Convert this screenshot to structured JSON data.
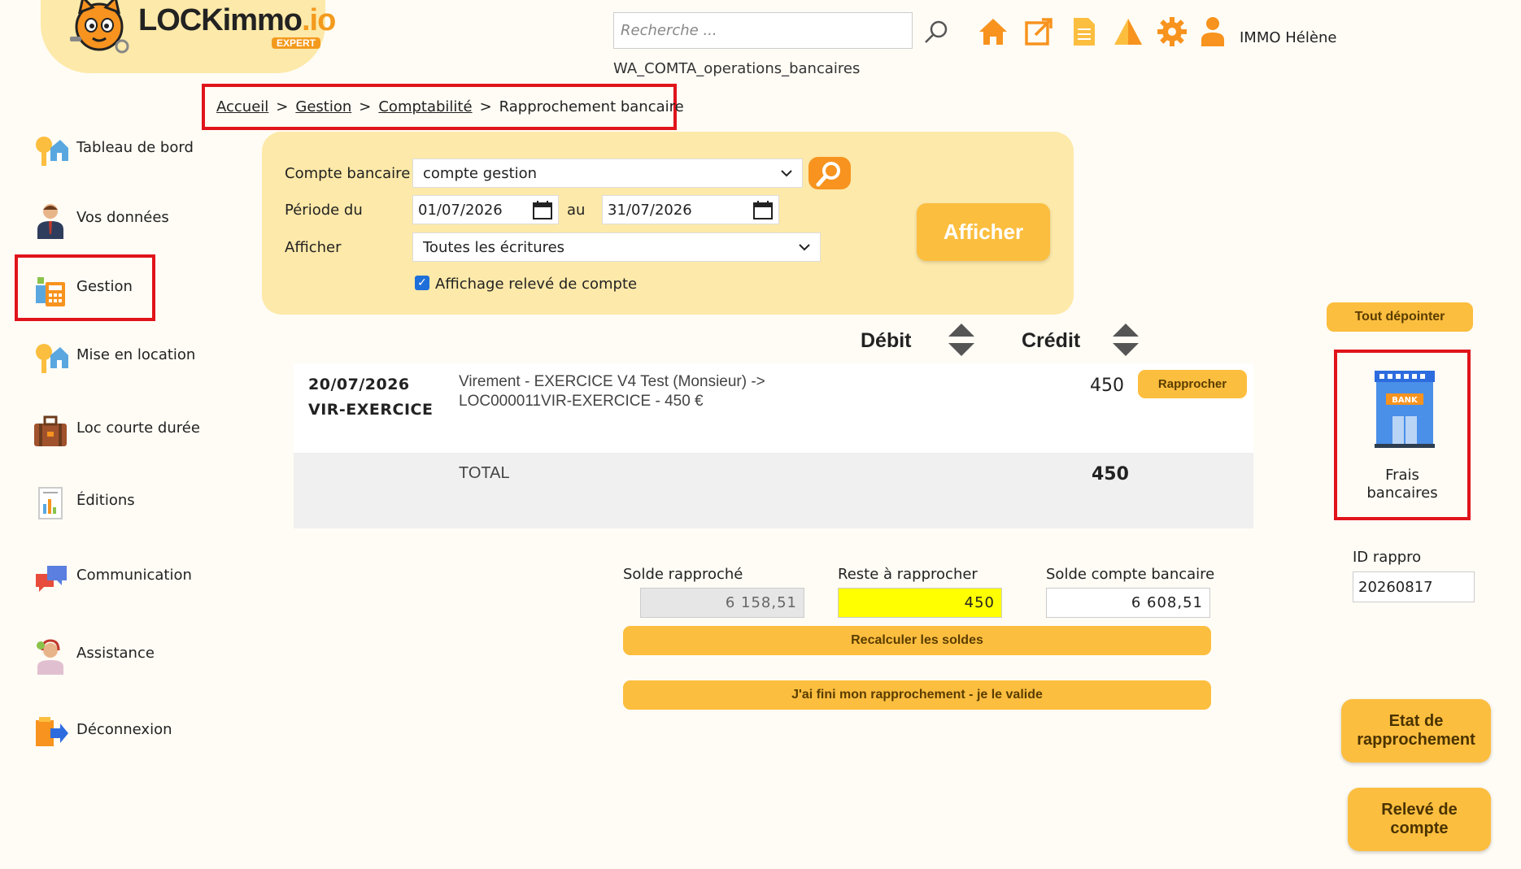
{
  "header": {
    "logo_text": "LOCKimmo",
    "logo_suffix": ".io",
    "logo_badge": "EXPERT",
    "search_placeholder": "Recherche ...",
    "user_name": "IMMO Hélène",
    "page_code": "WA_COMTA_operations_bancaires",
    "icons": [
      "search-icon",
      "home-icon",
      "external-link-icon",
      "document-icon",
      "alert-icon",
      "gear-icon",
      "user-icon"
    ]
  },
  "breadcrumb": {
    "items": [
      "Accueil",
      "Gestion",
      "Comptabilité"
    ],
    "current": "Rapprochement bancaire",
    "separator": ">"
  },
  "sidebar": {
    "items": [
      {
        "label": "Tableau de bord",
        "icon": "dashboard-key-icon"
      },
      {
        "label": "Vos données",
        "icon": "person-icon"
      },
      {
        "label": "Gestion",
        "icon": "calculator-icon",
        "active": true
      },
      {
        "label": "Mise en location",
        "icon": "key-house-icon"
      },
      {
        "label": "Loc courte durée",
        "icon": "suitcase-icon"
      },
      {
        "label": "Éditions",
        "icon": "report-icon"
      },
      {
        "label": "Communication",
        "icon": "chat-bubbles-icon"
      },
      {
        "label": "Assistance",
        "icon": "support-agent-icon"
      },
      {
        "label": "Déconnexion",
        "icon": "logout-icon"
      }
    ]
  },
  "filters": {
    "account_label": "Compte bancaire",
    "account_value": "compte gestion",
    "period_label": "Période du",
    "date_from": "01/07/2026",
    "to_label": "au",
    "date_to": "31/07/2026",
    "show_label": "Afficher",
    "show_value": "Toutes les écritures",
    "statement_checkbox_label": "Affichage relevé de compte",
    "statement_checked": true,
    "afficher_button": "Afficher"
  },
  "table": {
    "debit_header": "Débit",
    "credit_header": "Crédit",
    "rows": [
      {
        "date": "20/07/2026",
        "reference": "VIR-EXERCICE",
        "libelle": "Virement - EXERCICE V4 Test (Monsieur) -> LOC000011VIR-EXERCICE - 450 €",
        "credit": "450",
        "action": "Rapprocher"
      }
    ],
    "total_label": "TOTAL",
    "total_credit": "450"
  },
  "soldes": {
    "rapproche_label": "Solde rapproché",
    "rapproche_value": "6 158,51",
    "reste_label": "Reste à rapprocher",
    "reste_value": "450",
    "compte_label": "Solde compte bancaire",
    "compte_value": "6 608,51",
    "recalculer_button": "Recalculer les soldes",
    "valider_button": "J'ai fini mon rapprochement - je le valide"
  },
  "right_panel": {
    "depointer_button": "Tout dépointer",
    "frais_label_line1": "Frais",
    "frais_label_line2": "bancaires",
    "bank_sign": "BANK",
    "id_label": "ID rappro",
    "id_value": "20260817",
    "etat_line1": "Etat de",
    "etat_line2": "rapprochement",
    "releve_line1": "Relevé de",
    "releve_line2": "compte"
  },
  "colors": {
    "accent": "#fcbe3f",
    "panel_bg": "#fde9a9",
    "highlight_border": "#e0141b",
    "icon_orange": "#f7931e",
    "yellow_field": "#ffff00"
  }
}
